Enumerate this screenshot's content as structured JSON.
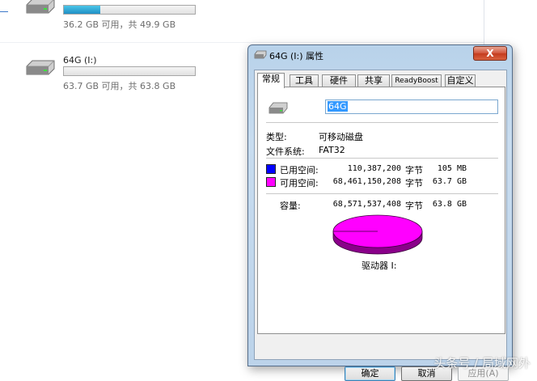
{
  "explorer": {
    "drives": [
      {
        "name": "",
        "free_text": "36.2 GB 可用，共 49.9 GB",
        "used_fraction": 0.275
      },
      {
        "name": "64G (I:)",
        "free_text": "63.7 GB 可用，共 63.8 GB",
        "used_fraction": 0.002
      }
    ]
  },
  "window": {
    "title": "64G (I:) 属性",
    "close_label": "X",
    "tabs": [
      "常规",
      "工具",
      "硬件",
      "共享",
      "ReadyBoost",
      "自定义"
    ],
    "active_tab": 0,
    "drive_name_value": "64G",
    "type_label": "类型:",
    "type_value": "可移动磁盘",
    "fs_label": "文件系统:",
    "fs_value": "FAT32",
    "used": {
      "label": "已用空间:",
      "bytes": "110,387,200",
      "unit": "字节",
      "size": "105 MB",
      "color": "#0000ff"
    },
    "free": {
      "label": "可用空间:",
      "bytes": "68,461,150,208",
      "unit": "字节",
      "size": "63.7 GB",
      "color": "#ff00ff"
    },
    "capacity": {
      "label": "容量:",
      "bytes": "68,571,537,408",
      "unit": "字节",
      "size": "63.8 GB"
    },
    "pie_used_fraction": 0.0016,
    "drive_caption": "驱动器 I:",
    "buttons": {
      "ok": "确定",
      "cancel": "取消",
      "apply": "应用(A)"
    }
  },
  "watermark": "头条号 / 局域网外"
}
